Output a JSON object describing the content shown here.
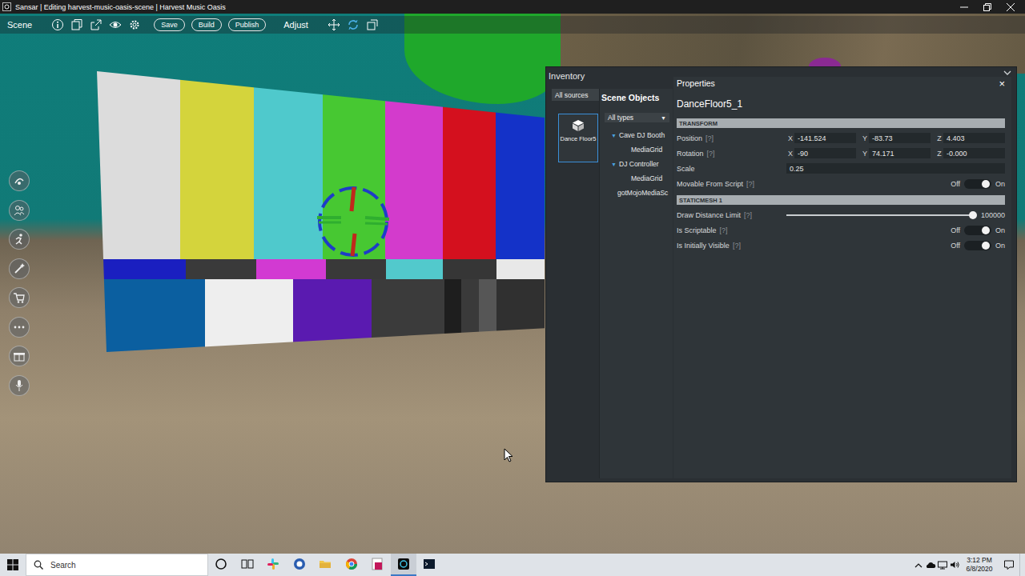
{
  "window": {
    "title": "Sansar | Editing harvest-music-oasis-scene | Harvest Music Oasis"
  },
  "toolbar": {
    "scene_label": "Scene",
    "buttons": [
      {
        "label": "Save"
      },
      {
        "label": "Build"
      },
      {
        "label": "Publish"
      }
    ],
    "adjust_label": "Adjust"
  },
  "inventory": {
    "title": "Inventory",
    "filter": "All sources",
    "items": [
      {
        "label": "Dance Floor5",
        "selected": true
      }
    ]
  },
  "scene_objects": {
    "title": "Scene Objects",
    "filter": "All types",
    "filter_arrow": "▼",
    "tree": [
      {
        "label": "Cave DJ Booth",
        "kind": "group",
        "arrow": "▼",
        "expanded": true,
        "children": [
          {
            "label": "MediaGrid"
          }
        ]
      },
      {
        "label": "DJ Controller",
        "kind": "group",
        "arrow": "▼",
        "expanded": true,
        "children": [
          {
            "label": "MediaGrid"
          }
        ]
      },
      {
        "label": "gotMojoMediaSc",
        "kind": "leaf"
      }
    ]
  },
  "properties": {
    "title": "Properties",
    "close": "×",
    "object_name": "DanceFloor5_1",
    "sections": [
      {
        "title": "TRANSFORM",
        "rows": [
          {
            "kind": "vector",
            "label": "Position",
            "help": "[?]",
            "fields": [
              {
                "axis": "X",
                "value": "-141.524"
              },
              {
                "axis": "Y",
                "value": "-83.73"
              },
              {
                "axis": "Z",
                "value": "4.403"
              }
            ]
          },
          {
            "kind": "vector",
            "label": "Rotation",
            "help": "[?]",
            "fields": [
              {
                "axis": "X",
                "value": "-90"
              },
              {
                "axis": "Y",
                "value": "74.171"
              },
              {
                "axis": "Z",
                "value": "-0.000"
              }
            ]
          },
          {
            "kind": "scalar",
            "label": "Scale",
            "value": "0.25"
          },
          {
            "kind": "toggle",
            "label": "Movable From Script",
            "help": "[?]",
            "off_label": "Off",
            "on_label": "On",
            "on": true
          }
        ]
      },
      {
        "title": "STATICMESH 1",
        "rows": [
          {
            "kind": "slider",
            "label": "Draw Distance Limit",
            "help": "[?]",
            "level": 1.0,
            "reading": "100000"
          },
          {
            "kind": "toggle",
            "label": "Is Scriptable",
            "help": "[?]",
            "off_label": "Off",
            "on_label": "On",
            "on": true
          },
          {
            "kind": "toggle",
            "label": "Is Initially Visible",
            "help": "[?]",
            "off_label": "Off",
            "on_label": "On",
            "on": true
          }
        ]
      }
    ]
  },
  "taskbar": {
    "search_placeholder": "Search",
    "apps": [
      {
        "kind": "cortana",
        "selected": false
      },
      {
        "kind": "taskview",
        "selected": false
      },
      {
        "kind": "slack",
        "selected": false
      },
      {
        "kind": "bluecircle",
        "selected": false
      },
      {
        "kind": "explorer",
        "selected": false
      },
      {
        "kind": "chrome",
        "selected": false
      },
      {
        "kind": "redapp",
        "selected": false
      },
      {
        "kind": "sansar",
        "selected": true
      },
      {
        "kind": "terminal",
        "selected": false
      }
    ],
    "time": "3:12 PM",
    "date": "6/8/2020"
  }
}
